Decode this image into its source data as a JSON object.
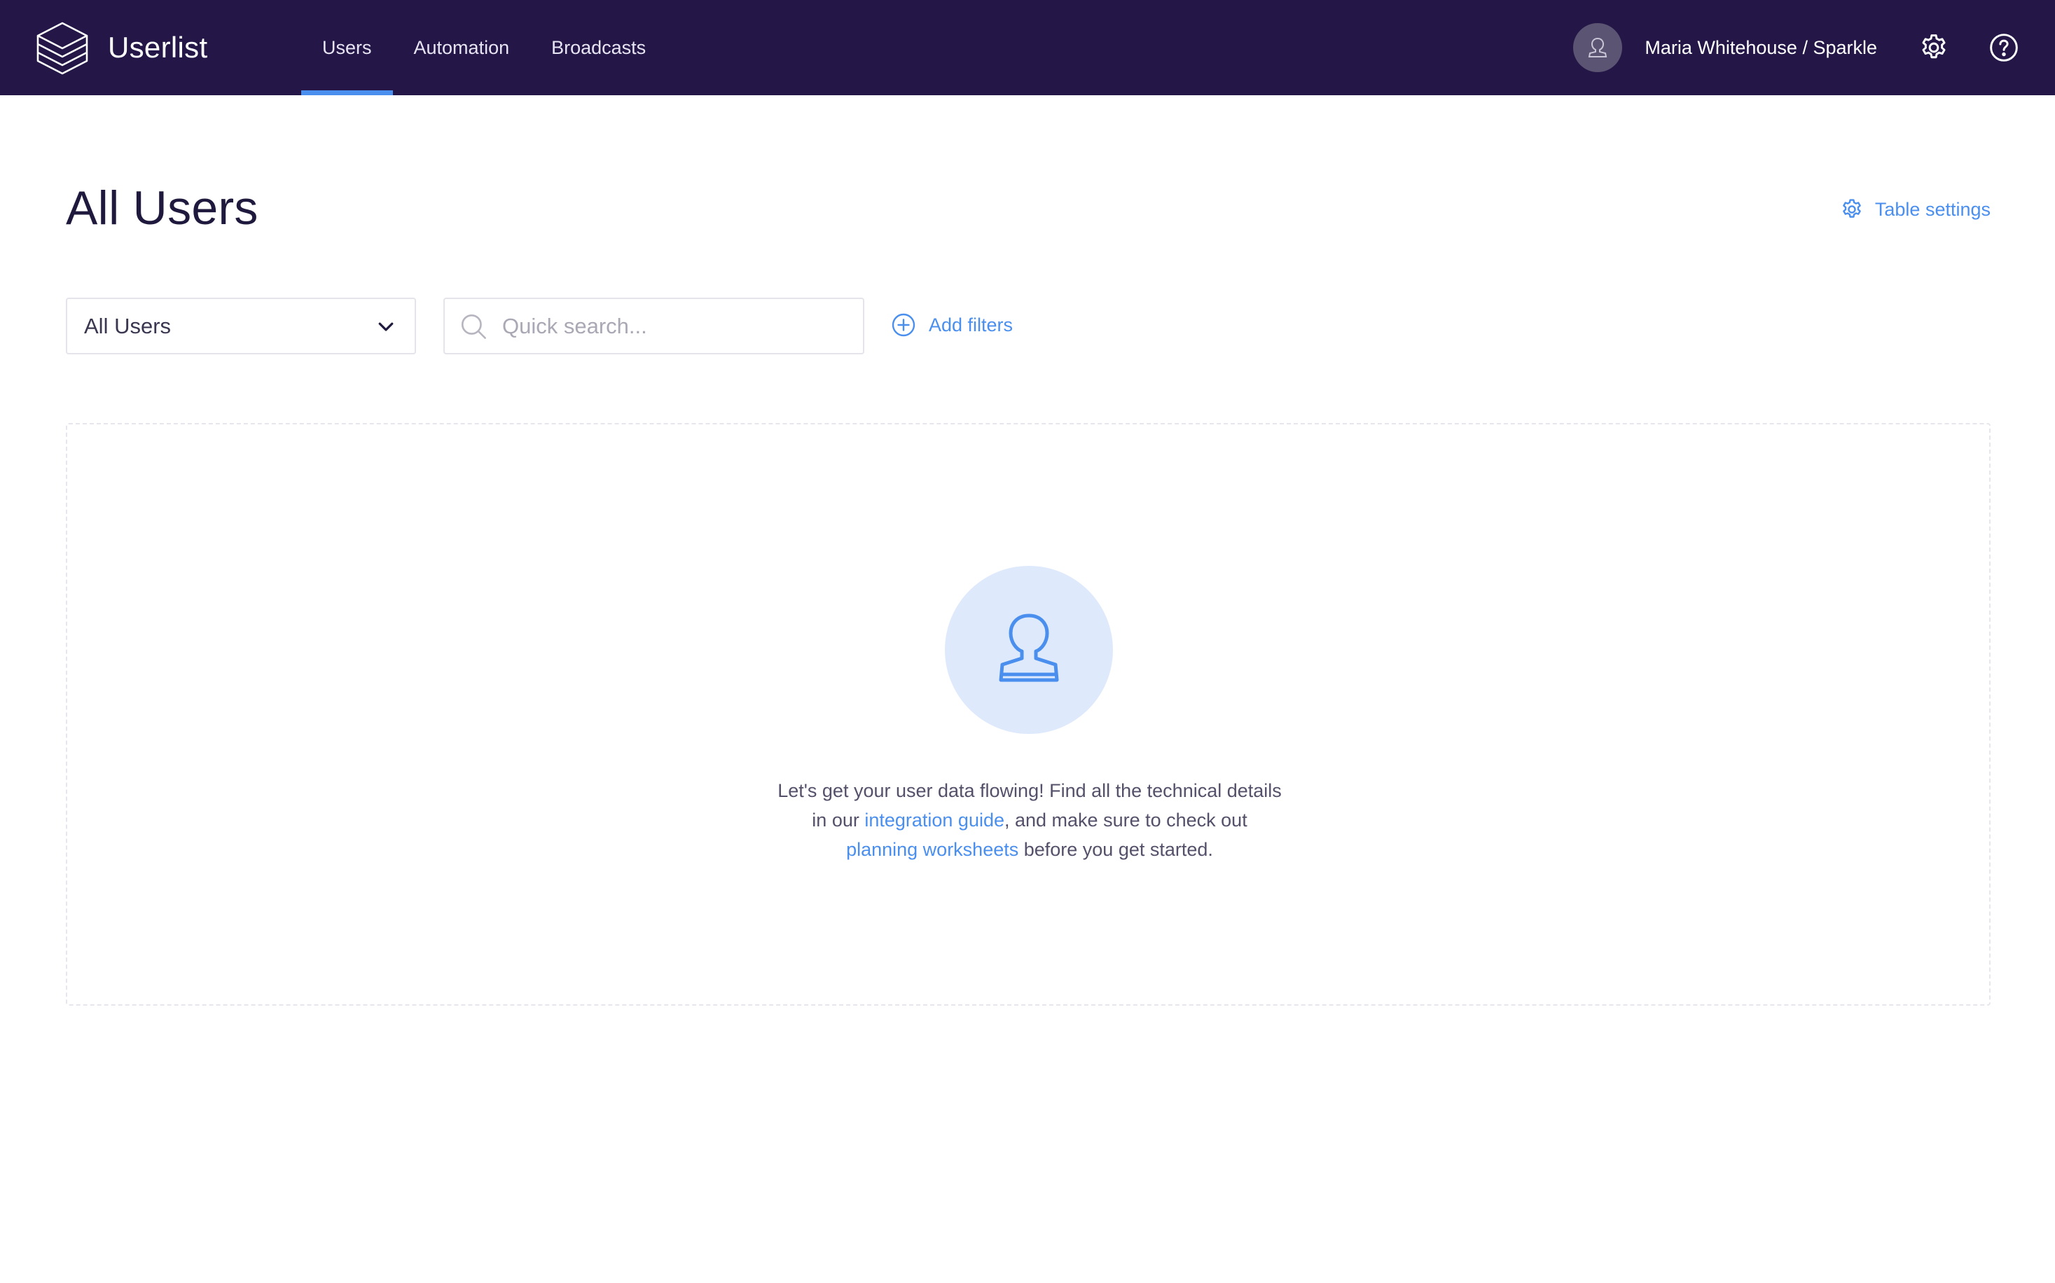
{
  "app": {
    "name": "Userlist"
  },
  "nav": {
    "items": [
      {
        "label": "Users",
        "active": true
      },
      {
        "label": "Automation",
        "active": false
      },
      {
        "label": "Broadcasts",
        "active": false
      }
    ]
  },
  "account": {
    "name": "Maria Whitehouse / Sparkle",
    "avatar_icon": "user-icon",
    "settings_icon": "gear-icon",
    "help_icon": "help-circle-icon"
  },
  "page": {
    "title": "All Users",
    "table_settings_label": "Table settings"
  },
  "filters": {
    "segment_selected": "All Users",
    "search_placeholder": "Quick search...",
    "search_value": "",
    "add_filters_label": "Add filters"
  },
  "empty_state": {
    "icon": "user-icon",
    "line1": "Let's get your user data flowing! Find all the technical details",
    "line2_prefix": "in our ",
    "integration_link": "integration guide",
    "line2_suffix": ", and make sure to check out",
    "worksheets_link": "planning worksheets",
    "line3_suffix": " before you get started."
  },
  "colors": {
    "topbar": "#241747",
    "accent": "#4a8fee",
    "illustration_bg": "#deeafc",
    "title": "#1f1a3d"
  }
}
